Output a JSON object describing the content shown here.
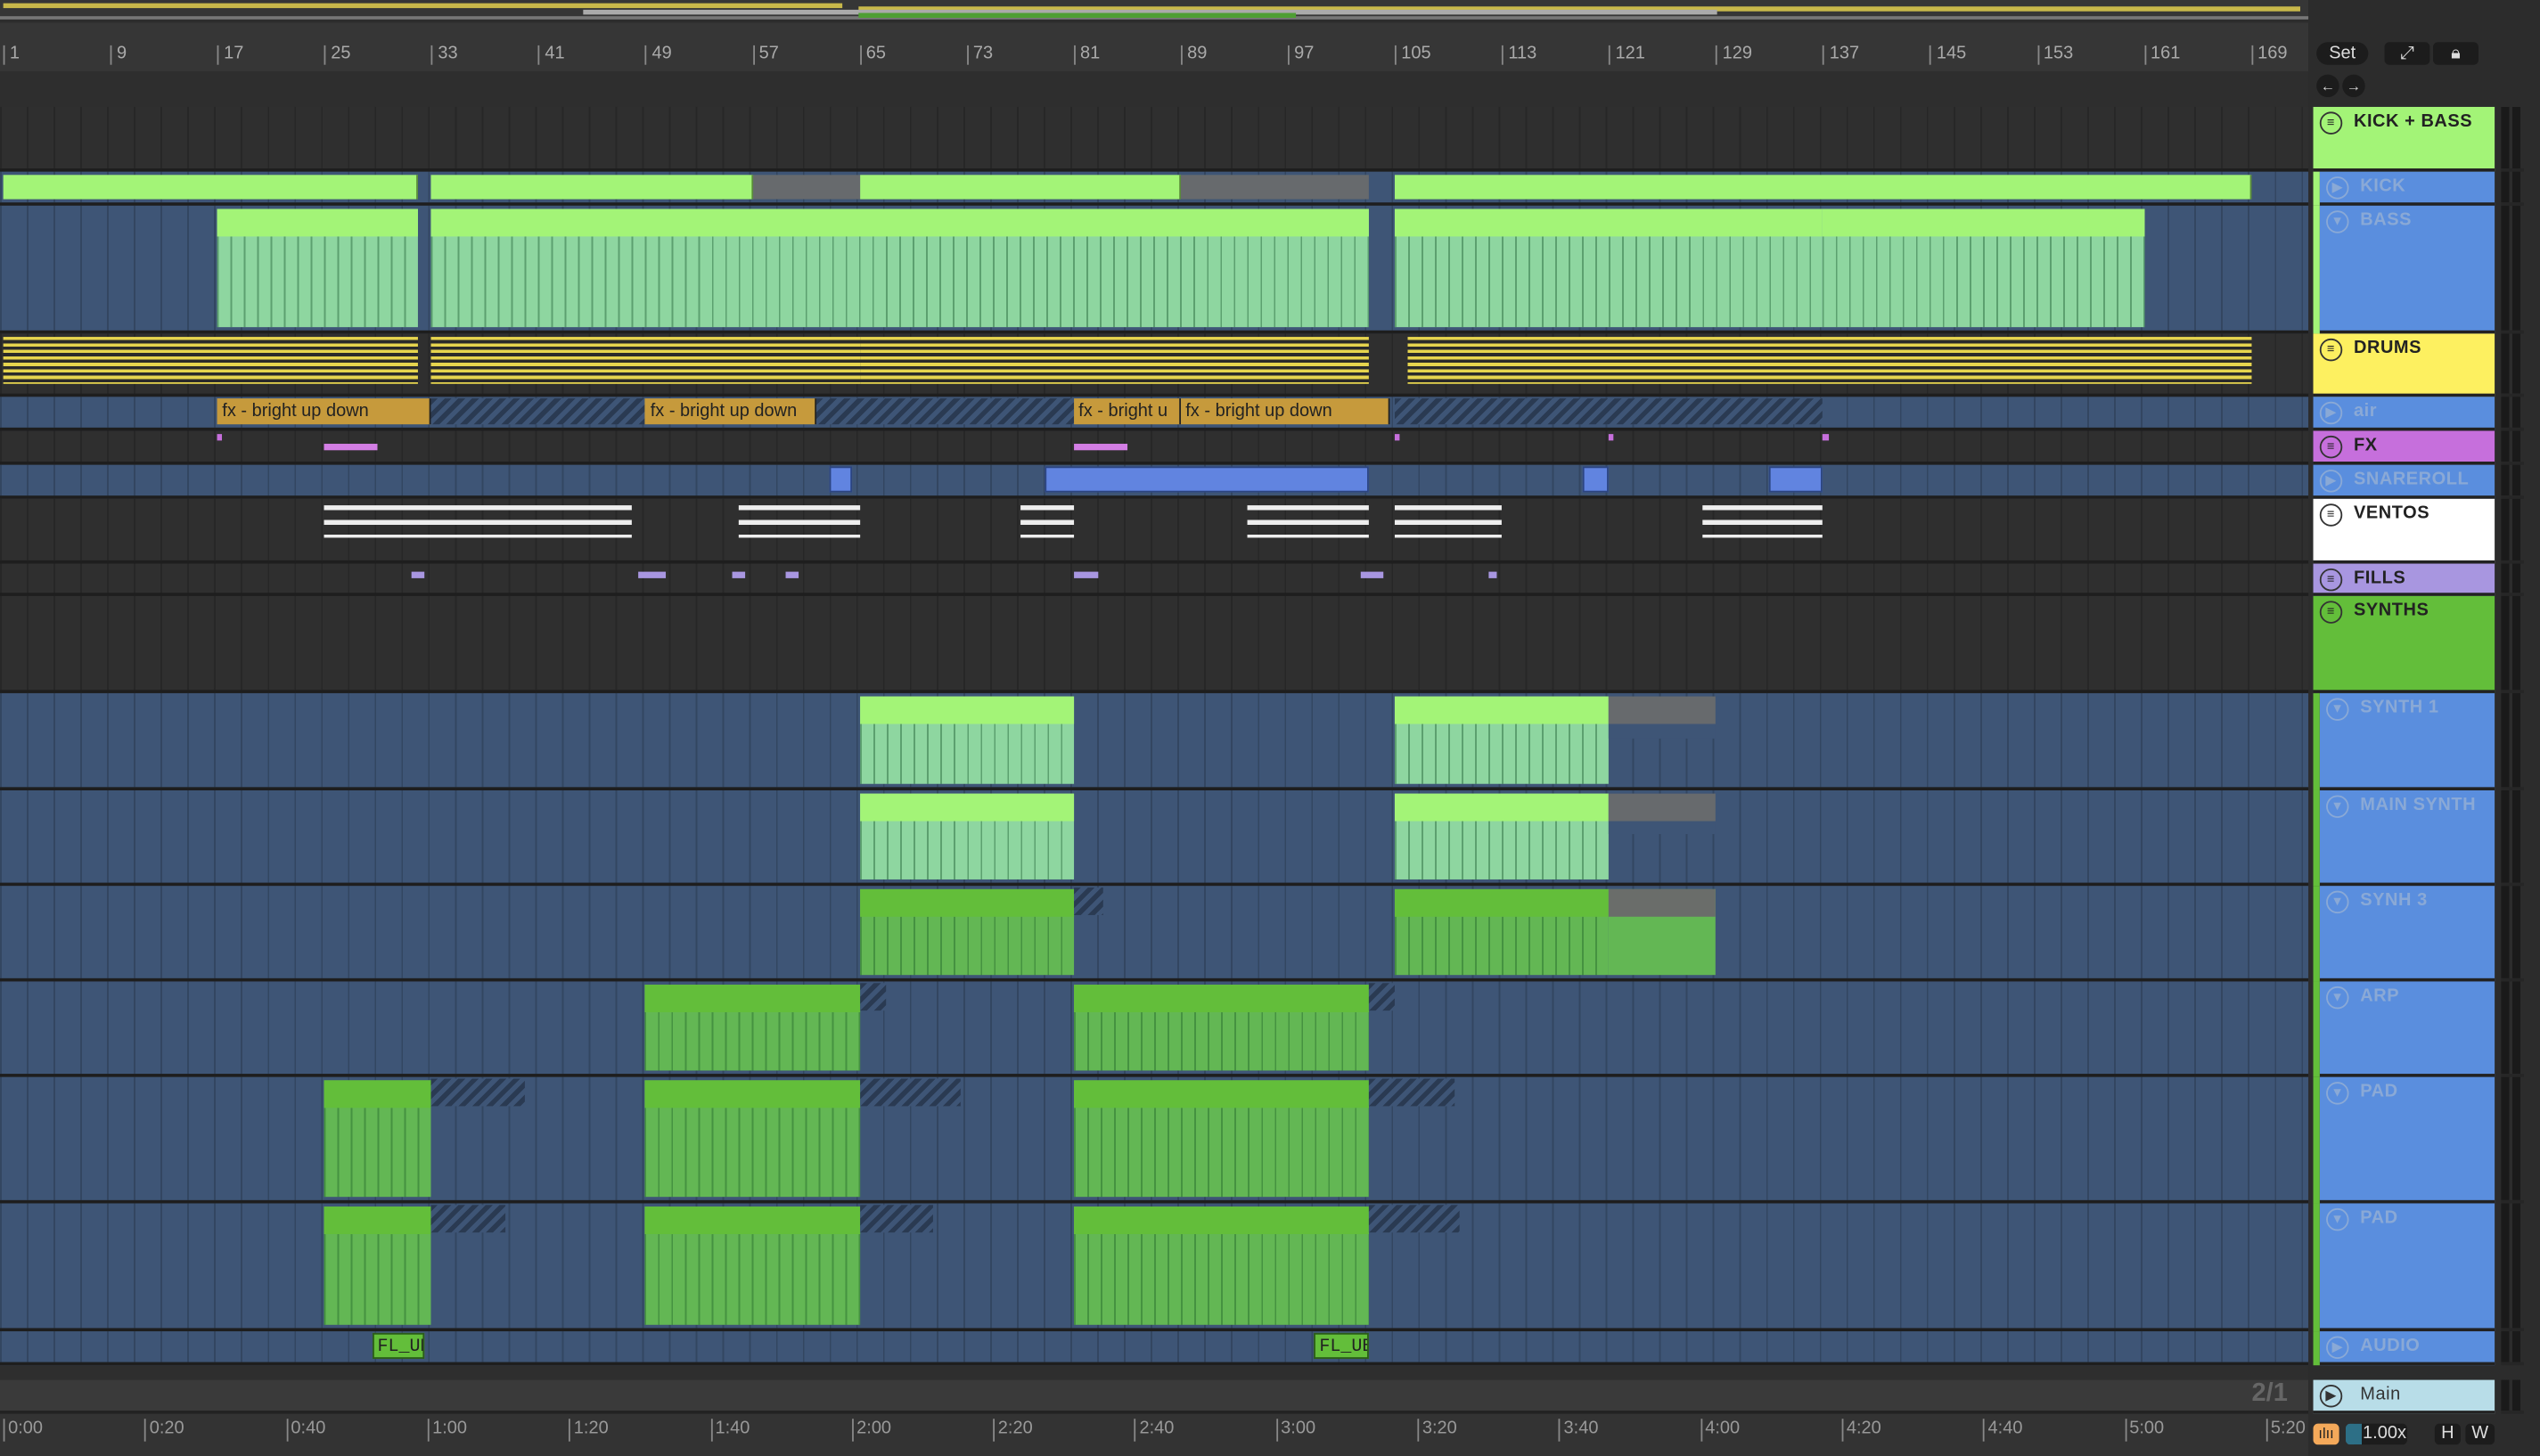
{
  "ruler": {
    "bars": [
      "1",
      "9",
      "17",
      "25",
      "33",
      "41",
      "49",
      "57",
      "65",
      "73",
      "81",
      "89",
      "97",
      "105",
      "113",
      "121",
      "129",
      "137",
      "145",
      "153",
      "161",
      "169"
    ]
  },
  "controls": {
    "set_label": "Set",
    "follow_icon": "draw-mode-icon",
    "lock_icon": "lock-icon",
    "back_icon": "arrow-left-icon",
    "fwd_icon": "arrow-right-icon"
  },
  "tracks": [
    {
      "name": "KICK + BASS",
      "type": "group",
      "color": "#a3f477",
      "clips": []
    },
    {
      "name": "KICK",
      "type": "sub",
      "icon": "play",
      "clips": [
        {
          "s": 1,
          "e": 32,
          "k": "g"
        },
        {
          "s": 33,
          "e": 57,
          "k": "g"
        },
        {
          "s": 57,
          "e": 65,
          "k": "gray"
        },
        {
          "s": 65,
          "e": 89,
          "k": "g"
        },
        {
          "s": 89,
          "e": 103,
          "k": "gray"
        },
        {
          "s": 105,
          "e": 169,
          "k": "g"
        }
      ]
    },
    {
      "name": "BASS",
      "type": "sub",
      "icon": "down",
      "clips": [
        {
          "s": 17,
          "e": 32,
          "k": "mint"
        },
        {
          "s": 33,
          "e": 103,
          "k": "mint"
        },
        {
          "s": 105,
          "e": 137,
          "k": "mint"
        },
        {
          "s": 137,
          "e": 161,
          "k": "mint"
        }
      ]
    },
    {
      "name": "DRUMS",
      "type": "group",
      "color": "#fdf060",
      "clips": [
        {
          "s": 1,
          "e": 32,
          "k": "y"
        },
        {
          "s": 33,
          "e": 65,
          "k": "y"
        },
        {
          "s": 65,
          "e": 103,
          "k": "y"
        },
        {
          "s": 106,
          "e": 169,
          "k": "y"
        }
      ]
    },
    {
      "name": "air",
      "type": "sub",
      "icon": "play",
      "clips": [
        {
          "s": 17,
          "e": 33,
          "k": "fx",
          "label": "fx - bright up down"
        },
        {
          "s": 33,
          "e": 49,
          "k": "hatch"
        },
        {
          "s": 49,
          "e": 61.8,
          "k": "fx",
          "label": "fx - bright up down"
        },
        {
          "s": 61.8,
          "e": 81,
          "k": "hatch"
        },
        {
          "s": 81,
          "e": 89,
          "k": "fx",
          "label": "fx - bright u"
        },
        {
          "s": 89,
          "e": 104.6,
          "k": "fx",
          "label": "fx - bright up down"
        },
        {
          "s": 105,
          "e": 137,
          "k": "hatch"
        }
      ]
    },
    {
      "name": "FX",
      "type": "group",
      "color": "#c66fdc",
      "clips": [
        {
          "s": 17,
          "e": 17.4,
          "k": "p"
        },
        {
          "s": 25,
          "e": 29,
          "k": "p2"
        },
        {
          "s": 81,
          "e": 85,
          "k": "p2"
        },
        {
          "s": 105,
          "e": 105.4,
          "k": "p"
        },
        {
          "s": 121,
          "e": 121.4,
          "k": "p"
        },
        {
          "s": 137,
          "e": 137.4,
          "k": "p"
        }
      ]
    },
    {
      "name": "SNAREROLL",
      "type": "sub",
      "icon": "play",
      "clips": [
        {
          "s": 62.8,
          "e": 64.5,
          "k": "blue"
        },
        {
          "s": 78.8,
          "e": 103,
          "k": "blue"
        },
        {
          "s": 119,
          "e": 121,
          "k": "blue"
        },
        {
          "s": 133,
          "e": 137,
          "k": "blue"
        }
      ]
    },
    {
      "name": "VENTOS",
      "type": "group",
      "color": "#ffffff",
      "clips": [
        {
          "s": 25,
          "e": 48,
          "k": "w"
        },
        {
          "s": 56,
          "e": 65,
          "k": "w"
        },
        {
          "s": 77,
          "e": 81,
          "k": "w"
        },
        {
          "s": 94,
          "e": 103,
          "k": "w"
        },
        {
          "s": 105,
          "e": 113,
          "k": "w"
        },
        {
          "s": 128,
          "e": 137,
          "k": "w"
        }
      ]
    },
    {
      "name": "FILLS",
      "type": "group",
      "color": "#a896e0",
      "clips": [
        {
          "s": 31.5,
          "e": 32.5,
          "k": "p3"
        },
        {
          "s": 48.5,
          "e": 50.5,
          "k": "p3"
        },
        {
          "s": 55.5,
          "e": 56.5,
          "k": "p3"
        },
        {
          "s": 59.5,
          "e": 60.5,
          "k": "p3"
        },
        {
          "s": 81,
          "e": 82.8,
          "k": "p3"
        },
        {
          "s": 102.5,
          "e": 104.2,
          "k": "p3"
        },
        {
          "s": 112,
          "e": 112.6,
          "k": "p3"
        }
      ]
    },
    {
      "name": "SYNTHS",
      "type": "group",
      "color": "#63be3a",
      "clips": []
    },
    {
      "name": "SYNTH 1",
      "type": "sub",
      "icon": "down",
      "clips": [
        {
          "s": 65,
          "e": 81,
          "k": "mint"
        },
        {
          "s": 105,
          "e": 121,
          "k": "mint"
        },
        {
          "s": 121,
          "e": 129,
          "k": "grayclip"
        }
      ]
    },
    {
      "name": "MAIN SYNTH",
      "type": "sub",
      "icon": "down",
      "clips": [
        {
          "s": 65,
          "e": 81,
          "k": "mint"
        },
        {
          "s": 105,
          "e": 121,
          "k": "mint"
        },
        {
          "s": 121,
          "e": 129,
          "k": "grayclip"
        }
      ]
    },
    {
      "name": "SYNH 3",
      "type": "sub",
      "icon": "down",
      "clips": [
        {
          "s": 65,
          "e": 81,
          "k": "dg"
        },
        {
          "s": 81,
          "e": 83.2,
          "k": "hatchg"
        },
        {
          "s": 105,
          "e": 121,
          "k": "dg"
        },
        {
          "s": 121,
          "e": 129,
          "k": "dgg"
        }
      ]
    },
    {
      "name": "ARP",
      "type": "sub",
      "icon": "down",
      "clips": [
        {
          "s": 49,
          "e": 65,
          "k": "dg"
        },
        {
          "s": 65,
          "e": 67,
          "k": "hatchg"
        },
        {
          "s": 81,
          "e": 103,
          "k": "dg"
        },
        {
          "s": 103,
          "e": 105,
          "k": "hatchg"
        }
      ]
    },
    {
      "name": "PAD",
      "type": "sub",
      "icon": "down",
      "clips": [
        {
          "s": 25,
          "e": 33,
          "k": "dg"
        },
        {
          "s": 33,
          "e": 40,
          "k": "hatchg"
        },
        {
          "s": 49,
          "e": 65,
          "k": "dg"
        },
        {
          "s": 65,
          "e": 72.5,
          "k": "hatchg"
        },
        {
          "s": 81,
          "e": 103,
          "k": "dg"
        },
        {
          "s": 103,
          "e": 109.5,
          "k": "hatchg"
        }
      ]
    },
    {
      "name": "PAD",
      "type": "sub",
      "icon": "down",
      "clips": [
        {
          "s": 25,
          "e": 33,
          "k": "dg"
        },
        {
          "s": 33,
          "e": 38.5,
          "k": "hatchg"
        },
        {
          "s": 49,
          "e": 65,
          "k": "dg"
        },
        {
          "s": 65,
          "e": 70.5,
          "k": "hatchg"
        },
        {
          "s": 81,
          "e": 103,
          "k": "dg"
        },
        {
          "s": 103,
          "e": 109.8,
          "k": "hatchg"
        }
      ]
    },
    {
      "name": "AUDIO",
      "type": "sub",
      "icon": "play",
      "clips": [
        {
          "s": 28.6,
          "e": 32.5,
          "k": "audio",
          "label": "FL_UB"
        },
        {
          "s": 99,
          "e": 103,
          "k": "audio",
          "label": "FL_UB"
        }
      ]
    }
  ],
  "main": {
    "name": "Main",
    "color": "#b8dde8",
    "meter_signature": "2/1"
  },
  "time_ruler": [
    "0:00",
    "0:20",
    "0:40",
    "1:00",
    "1:20",
    "1:40",
    "2:00",
    "2:20",
    "2:40",
    "3:00",
    "3:20",
    "3:40",
    "4:00",
    "4:20",
    "4:40",
    "5:00",
    "5:20"
  ],
  "footer": {
    "zoom": "1.00x",
    "h_label": "H",
    "w_label": "W",
    "accent": "#f4a95a"
  }
}
